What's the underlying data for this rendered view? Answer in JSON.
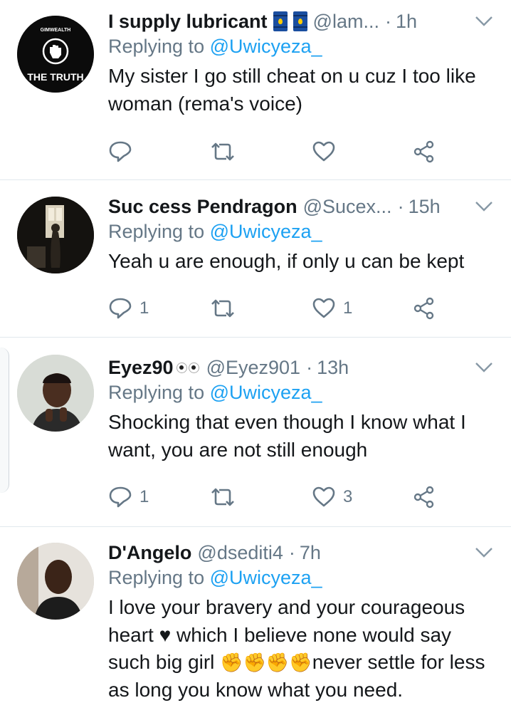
{
  "tweets": [
    {
      "name": "I supply lubricant",
      "handle": "@lam...",
      "time": "1h",
      "reply_prefix": "Replying to",
      "reply_to": "@Uwicyeza_",
      "text": "My sister  I go still cheat on u cuz I too like woman (rema's voice)",
      "reply_count": "",
      "like_count": "",
      "avatar_top_text": "GIMWEALTH",
      "avatar_bottom_text": "THE TRUTH"
    },
    {
      "name": "Suc cess Pendragon",
      "handle": "@Sucex...",
      "time": "15h",
      "reply_prefix": "Replying to",
      "reply_to": "@Uwicyeza_",
      "text": "Yeah u are enough, if only u can be kept",
      "reply_count": "1",
      "like_count": "1"
    },
    {
      "name": "Eyez90",
      "handle": "@Eyez901",
      "time": "13h",
      "reply_prefix": "Replying to",
      "reply_to": "@Uwicyeza_",
      "text": "Shocking that even though I know what I want, you are not still enough",
      "reply_count": "1",
      "like_count": "3"
    },
    {
      "name": "D'Angelo",
      "handle": "@dsediti4",
      "time": "7h",
      "reply_prefix": "Replying to",
      "reply_to": "@Uwicyeza_",
      "text_part1": "I love your bravery and your courageous heart",
      "heart_glyph": "♥",
      "text_part2": "which I believe none would say such big girl",
      "fists": "✊✊✊✊",
      "text_part3": "never settle for less as long you know what you need."
    }
  ],
  "icons": {
    "reply": "reply-icon",
    "retweet": "retweet-icon",
    "like": "heart-icon",
    "share": "share-icon",
    "menu": "chevron-down-icon"
  },
  "colors": {
    "link": "#1da1f2",
    "secondary": "#657786",
    "separator": "#e1e8ed"
  }
}
